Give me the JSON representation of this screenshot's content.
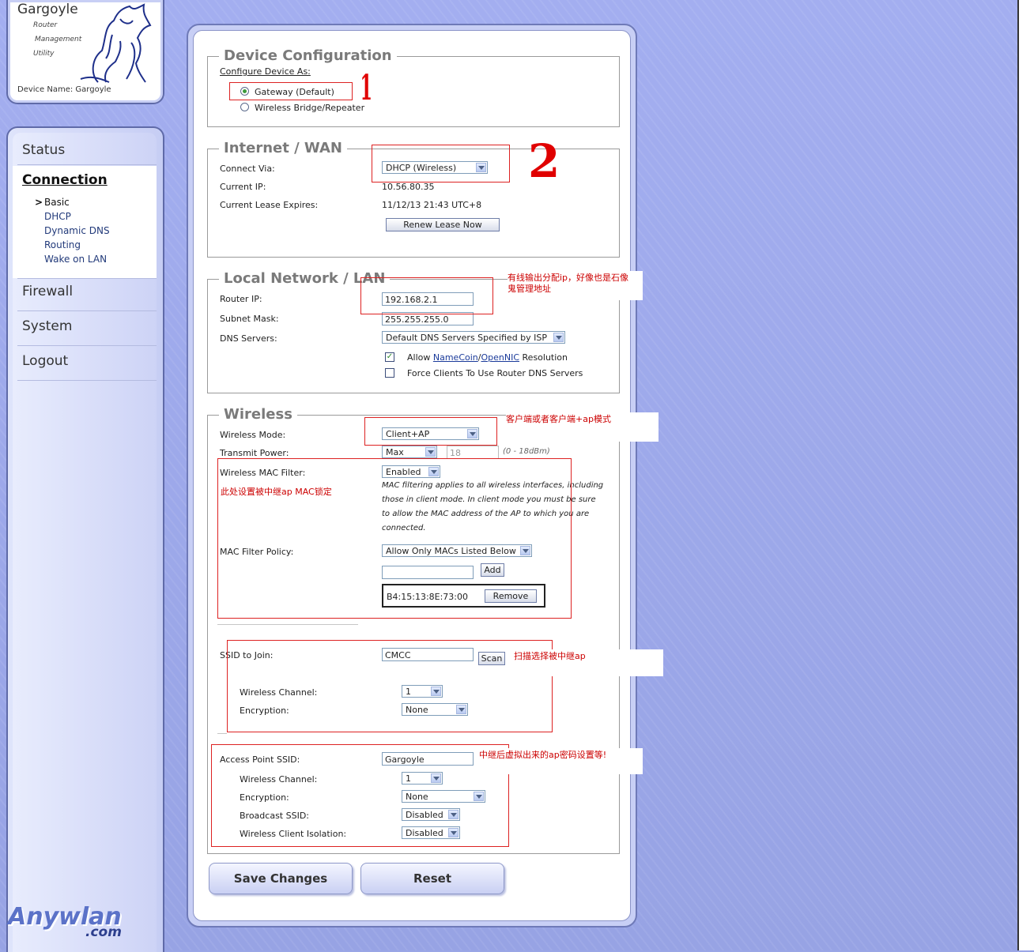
{
  "logo": {
    "title": "Gargoyle",
    "sub1": "Router",
    "sub2": "Management",
    "sub3": "Utility",
    "device_name": "Device Name: Gargoyle"
  },
  "nav": {
    "status": "Status",
    "connection": "Connection",
    "sub_items": [
      "Basic",
      "DHCP",
      "Dynamic DNS",
      "Routing",
      "Wake on LAN"
    ],
    "selected_marker": ">",
    "firewall": "Firewall",
    "system": "System",
    "logout": "Logout"
  },
  "watermark": {
    "main": "Anywlan",
    "com": ".com"
  },
  "device_config": {
    "legend": "Device Configuration",
    "configure_label": "Configure Device As:",
    "option_gateway": "Gateway (Default)",
    "option_bridge": "Wireless Bridge/Repeater",
    "selected": "gateway"
  },
  "wan": {
    "legend": "Internet / WAN",
    "connect_via_label": "Connect Via:",
    "connect_via_value": "DHCP (Wireless)",
    "current_ip_label": "Current IP:",
    "current_ip_value": "10.56.80.35",
    "lease_label": "Current Lease Expires:",
    "lease_value": "11/12/13 21:43 UTC+8",
    "renew_button": "Renew Lease Now"
  },
  "lan": {
    "legend": "Local Network / LAN",
    "router_ip_label": "Router IP:",
    "router_ip_value": "192.168.2.1",
    "subnet_label": "Subnet Mask:",
    "subnet_value": "255.255.255.0",
    "dns_label": "DNS Servers:",
    "dns_value": "Default DNS Servers Specified by ISP",
    "allow_prefix": "Allow ",
    "namecoin": "NameCoin",
    "slash": "/",
    "opennic": "OpenNIC",
    "allow_suffix": " Resolution",
    "allow_checked": true,
    "force_label": "Force Clients To Use Router DNS Servers",
    "force_checked": false
  },
  "wireless": {
    "legend": "Wireless",
    "mode_label": "Wireless Mode:",
    "mode_value": "Client+AP",
    "tx_label": "Transmit Power:",
    "tx_value": "Max",
    "tx_dbm": "18",
    "tx_range": "(0 - 18dBm)",
    "mac_filter_label": "Wireless MAC Filter:",
    "mac_filter_value": "Enabled",
    "mac_note": [
      "MAC filtering applies to all wireless interfaces, including",
      "those in client mode. In client mode you must be sure",
      "to allow the MAC address of the AP to which you are",
      "connected."
    ],
    "mac_policy_label": "MAC Filter Policy:",
    "mac_policy_value": "Allow Only MACs Listed Below",
    "add_button": "Add",
    "mac_entry": "B4:15:13:8E:73:00",
    "remove_button": "Remove",
    "ssid_label": "SSID to Join:",
    "ssid_value": "CMCC",
    "scan_button": "Scan",
    "client_channel_label": "Wireless Channel:",
    "client_channel_value": "1",
    "client_enc_label": "Encryption:",
    "client_enc_value": "None",
    "ap_ssid_label": "Access Point SSID:",
    "ap_ssid_value": "Gargoyle",
    "ap_channel_label": "Wireless Channel:",
    "ap_channel_value": "1",
    "ap_enc_label": "Encryption:",
    "ap_enc_value": "None",
    "broadcast_label": "Broadcast SSID:",
    "broadcast_value": "Disabled",
    "isolation_label": "Wireless Client Isolation:",
    "isolation_value": "Disabled"
  },
  "buttons": {
    "save": "Save Changes",
    "reset": "Reset"
  },
  "annotations": {
    "mark1": "1",
    "mark2": "2",
    "lan_note_1": "有线输出分配ip，好像也是石像",
    "lan_note_2": "鬼管理地址",
    "mode_note": "客户端或者客户端+ap模式",
    "mac_note": "此处设置被中继ap MAC锁定",
    "scan_note": "扫描选择被中继ap",
    "ap_note": "中继后虚拟出来的ap密码设置等!"
  },
  "colors": {
    "background": "#9aa6e6",
    "annotation": "#cc0000",
    "legend": "#7a7a7a"
  }
}
